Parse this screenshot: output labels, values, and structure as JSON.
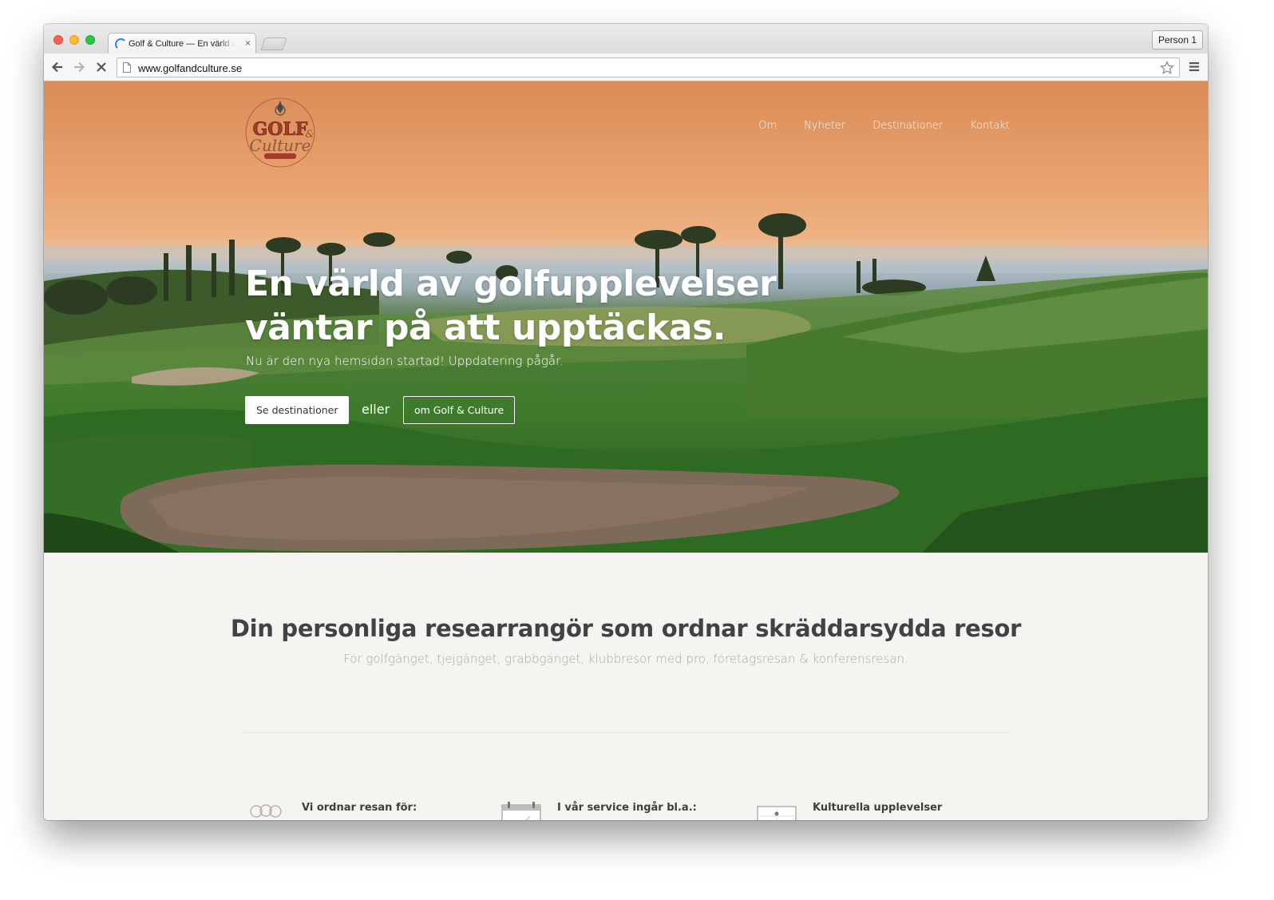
{
  "browser": {
    "tab_title": "Golf & Culture — En värld av golfupplevelser",
    "tab_close": "×",
    "profile_label": "Person 1",
    "url": "www.golfandculture.se"
  },
  "site": {
    "logo_text": "GOLF & Culture",
    "nav": [
      "Om",
      "Nyheter",
      "Destinationer",
      "Kontakt"
    ]
  },
  "hero": {
    "title_line1": "En värld av golfupplevelser",
    "title_line2": "väntar på att upptäckas.",
    "subtitle": "Nu är den nya hemsidan startad! Uppdatering pågår.",
    "primary_button": "Se destinationer",
    "or_text": "eller",
    "secondary_button": "om Golf & Culture"
  },
  "intro": {
    "title": "Din personliga researrangör som ordnar skräddarsydda resor",
    "subtitle": "För golfgänget, tjejgänget, grabbgänget, klubbresor med pro, företagsresan & konferensresan."
  },
  "features": [
    {
      "title": "Vi ordnar resan för:",
      "icon": "group-icon"
    },
    {
      "title": "I vår service ingår bl.a.:",
      "icon": "calendar-icon"
    },
    {
      "title": "Kulturella upplevelser",
      "icon": "map-icon"
    }
  ]
}
